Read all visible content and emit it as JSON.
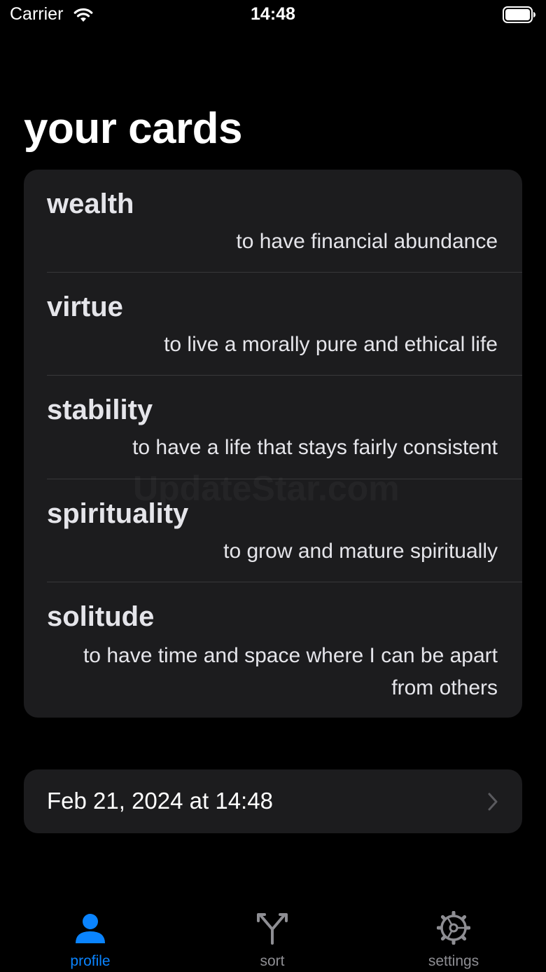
{
  "status_bar": {
    "carrier": "Carrier",
    "time": "14:48",
    "wifi_icon": "wifi-icon",
    "battery_icon": "battery-icon"
  },
  "page": {
    "title": "your cards"
  },
  "cards": [
    {
      "title": "wealth",
      "description": "to have financial abundance"
    },
    {
      "title": "virtue",
      "description": "to live a morally pure and ethical life"
    },
    {
      "title": "stability",
      "description": "to have a life that stays fairly consistent"
    },
    {
      "title": "spirituality",
      "description": "to grow and mature spiritually"
    },
    {
      "title": "solitude",
      "description": "to have time and space where I can be apart from others"
    }
  ],
  "date_row": {
    "label": "Feb 21, 2024 at 14:48",
    "chevron_icon": "chevron-right-icon"
  },
  "watermark": "UpdateStar.com",
  "tab_bar": {
    "tabs": [
      {
        "label": "profile",
        "icon": "person-icon",
        "selected": true
      },
      {
        "label": "sort",
        "icon": "fork-icon",
        "selected": false
      },
      {
        "label": "settings",
        "icon": "gear-icon",
        "selected": false
      }
    ]
  },
  "colors": {
    "background": "#000000",
    "panel": "#1c1c1e",
    "accent": "#0a84ff",
    "inactive": "#8e8e93",
    "text": "#e5e5ea"
  }
}
